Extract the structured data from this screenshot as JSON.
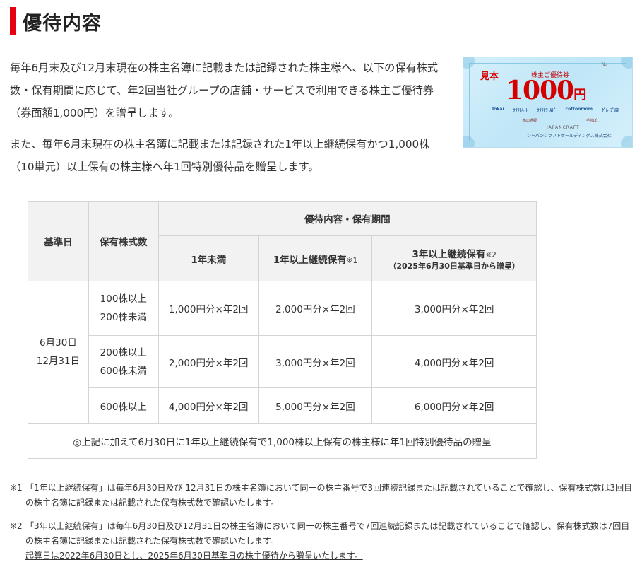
{
  "section": {
    "title": "優待内容"
  },
  "intro": {
    "paragraph1": "毎年6月末及び12月末現在の株主名簿に記載または記録された株主様へ、以下の保有株式数・保有期間に応じて、年2回当社グループの店舗・サービスで利用できる株主ご優待券（券面額1,000円）を贈呈します。",
    "paragraph2": "また、毎年6月末現在の株主名簿に記載または記録された1年以上継続保有かつ1,000株（10単元）以上保有の株主様へ年1回特別優待品を贈呈します。"
  },
  "voucher": {
    "no_label": "№",
    "sample_label": "見本",
    "title": "株主ご優待券",
    "amount": "1000",
    "currency": "円",
    "brands": [
      "Tokai",
      "ｸﾗﾌﾄﾊｰﾄ",
      "ｸﾗﾌﾄﾜｰﾙﾄﾞ",
      "cottonmom",
      "ｸﾞﾙｰﾌﾟ店"
    ],
    "brands2": [
      "布の通販",
      "手芸ぽこ"
    ],
    "group": "JAPANCRAFT",
    "company": "ジャパンクラフトホールディングス株式会社"
  },
  "table": {
    "header": {
      "base_date": "基準日",
      "shares_held": "保有株式数",
      "benefit_period": "優待内容・保有期間",
      "col_under_1y": "1年未満",
      "col_1y_plus": "1年以上継続保有",
      "col_1y_plus_note": "※1",
      "col_3y_plus": "3年以上継続保有",
      "col_3y_plus_note": "※2",
      "col_3y_plus_sub": "（2025年6月30日基準日から贈呈）"
    },
    "base_dates": [
      "6月30日",
      "12月31日"
    ],
    "rows": [
      {
        "shares": [
          "100株以上",
          "200株未満"
        ],
        "under_1y": "1,000円分×年2回",
        "one_y": "2,000円分×年2回",
        "three_y": "3,000円分×年2回"
      },
      {
        "shares": [
          "200株以上",
          "600株未満"
        ],
        "under_1y": "2,000円分×年2回",
        "one_y": "3,000円分×年2回",
        "three_y": "4,000円分×年2回"
      },
      {
        "shares": [
          "600株以上"
        ],
        "under_1y": "4,000円分×年2回",
        "one_y": "5,000円分×年2回",
        "three_y": "6,000円分×年2回"
      }
    ],
    "footer": "◎上記に加えて6月30日に1年以上継続保有で1,000株以上保有の株主様に年1回特別優待品の贈呈"
  },
  "notes": [
    {
      "mark": "※1",
      "text": "「1年以上継続保有」は毎年6月30日及び 12月31日の株主名簿において同一の株主番号で3回連続記録または記載されていることで確認し、保有株式数は3回目の株主名簿に記録または記載された保有株式数で確認いたします。"
    },
    {
      "mark": "※2",
      "text": "「3年以上継続保有」は毎年6月30日及び12月31日の株主名簿において同一の株主番号で7回連続記録または記載されていることで確認し、保有株式数は7回目の株主名簿に記録または記載された保有株式数で確認いたします。",
      "underlined": "起算日は2022年6月30日とし、2025年6月30日基準日の株主優待から贈呈いたします。"
    }
  ],
  "colors": {
    "accent_bar": "#e60012",
    "table_header_bg": "#f2f2f2",
    "table_border": "#d4d4d4",
    "voucher_bg": "#cdeaf8",
    "voucher_red": "#d40000"
  }
}
